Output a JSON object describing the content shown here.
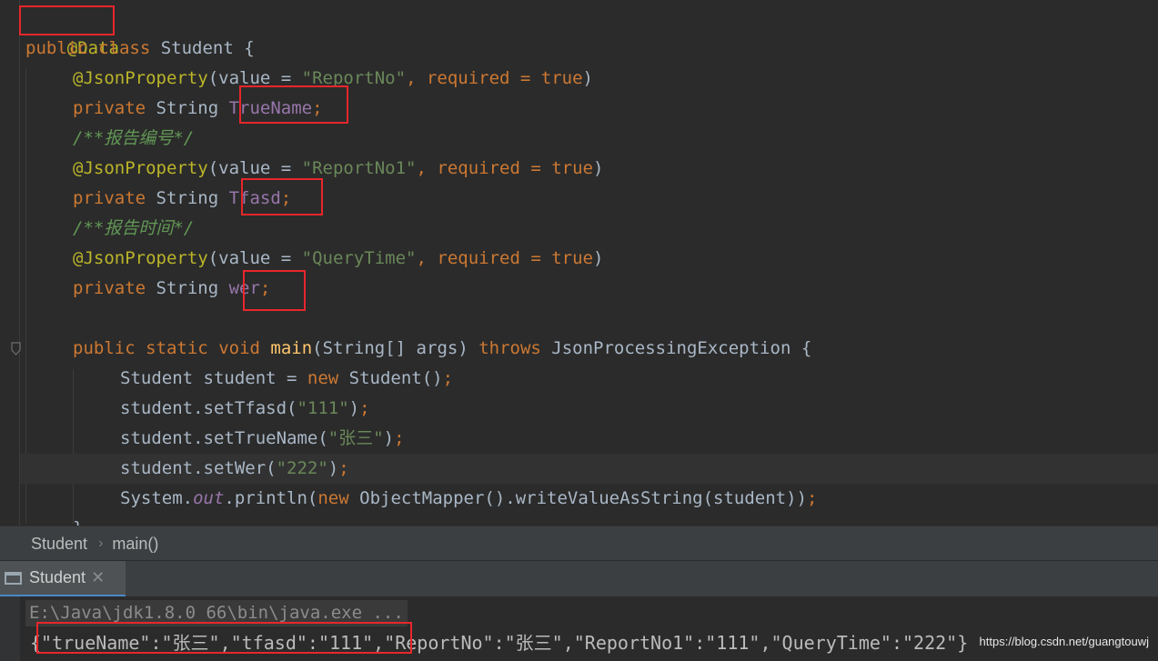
{
  "editor": {
    "lines": {
      "l1": {
        "annotation": "@Data"
      },
      "l2": {
        "kw_public": "public",
        "kw_class": "class",
        "class_name": " Student {"
      },
      "l3": {
        "annotation": "@JsonProperty",
        "open": "(value = ",
        "str": "\"ReportNo\"",
        "mid": ", required = ",
        "kw_true": "true",
        "close": ")"
      },
      "l4": {
        "kw_private": "private",
        "type": " String ",
        "field": "TrueName",
        "semi": ";"
      },
      "l5": {
        "comment": "/**报告编号*/"
      },
      "l6": {
        "annotation": "@JsonProperty",
        "open": "(value = ",
        "str": "\"ReportNo1\"",
        "mid": ", required = ",
        "kw_true": "true",
        "close": ")"
      },
      "l7": {
        "kw_private": "private",
        "type": " String ",
        "field": "Tfasd",
        "semi": ";"
      },
      "l8": {
        "comment": "/**报告时间*/"
      },
      "l9": {
        "annotation": "@JsonProperty",
        "open": "(value = ",
        "str": "\"QueryTime\"",
        "mid": ", required = ",
        "kw_true": "true",
        "close": ")"
      },
      "l10": {
        "kw_private": "private",
        "type": " String ",
        "field": "wer",
        "semi": ";"
      },
      "l12": {
        "kw_public": "public",
        "kw_static": "static",
        "kw_void": "void",
        "method": "main",
        "params": "(String[] args) ",
        "kw_throws": "throws",
        "exception": " JsonProcessingException {"
      },
      "l13": {
        "pre": "Student student = ",
        "kw_new": "new",
        "post": " Student()",
        "semi": ";"
      },
      "l14": {
        "pre": "student.setTfasd(",
        "str": "\"111\"",
        "post": ")",
        "semi": ";"
      },
      "l15": {
        "pre": "student.setTrueName(",
        "str": "\"张三\"",
        "post": ")",
        "semi": ";"
      },
      "l16": {
        "pre": "student.setWer(",
        "str": "\"222\"",
        "post": ")",
        "semi": ";"
      },
      "l17": {
        "pre": "System.",
        "static_field": "out",
        "mid": ".println(",
        "kw_new": "new",
        "post": " ObjectMapper().writeValueAsString(student))",
        "semi": ";"
      },
      "l18": {
        "text": "}"
      }
    }
  },
  "breadcrumb": {
    "class": "Student",
    "separator": "›",
    "method": "main()"
  },
  "run_panel": {
    "tab_label": "Student",
    "close_symbol": "✕"
  },
  "console": {
    "command": "E:\\Java\\jdk1.8.0_66\\bin\\java.exe ...",
    "output": "{\"trueName\":\"张三\",\"tfasd\":\"111\",\"ReportNo\":\"张三\",\"ReportNo1\":\"111\",\"QueryTime\":\"222\"}",
    "watermark": "https://blog.csdn.net/guangtouwj"
  },
  "colors": {
    "highlight_box": "#e8262b",
    "keyword": "#cc7832",
    "annotation": "#bbb529",
    "string": "#6a8759",
    "field": "#9876aa",
    "comment": "#629755",
    "method": "#ffc66d"
  }
}
